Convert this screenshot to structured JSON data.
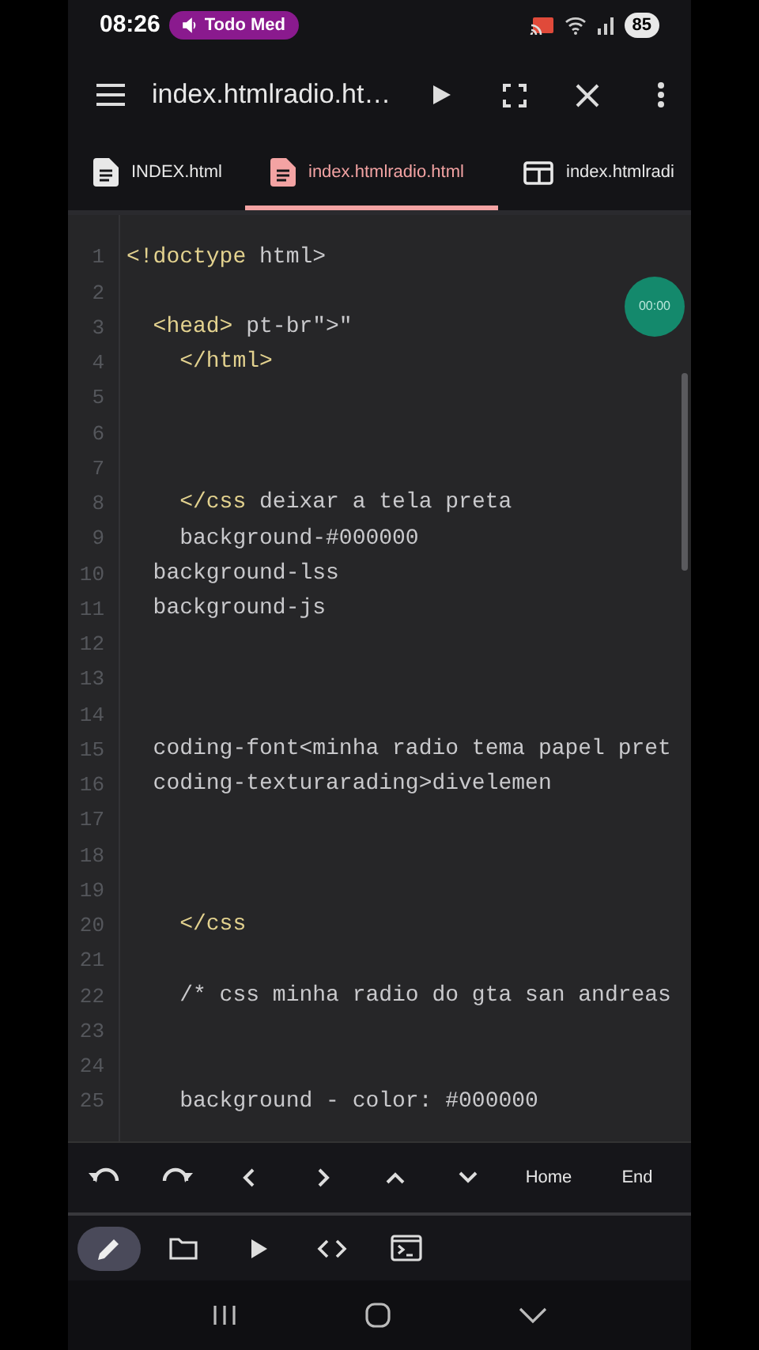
{
  "status_bar": {
    "time": "08:26",
    "media_pill": "Todo Med",
    "battery": "85"
  },
  "app_bar": {
    "title": "index.htmlradio.ht…"
  },
  "tabs": [
    {
      "label": "INDEX.html",
      "kind": "file",
      "selected": false
    },
    {
      "label": "index.htmlradio.html",
      "kind": "file",
      "selected": true
    },
    {
      "label": "index.htmlradi",
      "kind": "preview",
      "selected": false
    }
  ],
  "editor": {
    "lines": [
      {
        "number": "1",
        "segments": [
          {
            "kind": "tag",
            "text": "<!doctype"
          },
          {
            "kind": "text",
            "text": " html>"
          }
        ]
      },
      {
        "number": "2"
      },
      {
        "number": "3",
        "segments": [
          {
            "kind": "tag",
            "text": "  <head>"
          },
          {
            "kind": "text",
            "text": " pt-br\">\""
          }
        ]
      },
      {
        "number": "4",
        "segments": [
          {
            "kind": "tag",
            "text": "    </html>"
          }
        ]
      },
      {
        "number": "5"
      },
      {
        "number": "6"
      },
      {
        "number": "7"
      },
      {
        "number": "8",
        "segments": [
          {
            "kind": "tag",
            "text": "    </css"
          },
          {
            "kind": "text",
            "text": " deixar a tela preta"
          }
        ]
      },
      {
        "number": "9",
        "segments": [
          {
            "kind": "text",
            "text": "    background-#000000"
          }
        ]
      },
      {
        "number": "10",
        "segments": [
          {
            "kind": "text",
            "text": "  background-lss"
          }
        ]
      },
      {
        "number": "11",
        "segments": [
          {
            "kind": "text",
            "text": "  background-js"
          }
        ]
      },
      {
        "number": "12"
      },
      {
        "number": "13"
      },
      {
        "number": "14"
      },
      {
        "number": "15",
        "segments": [
          {
            "kind": "text",
            "text": "  coding-font<minha radio tema papel pret"
          }
        ]
      },
      {
        "number": "16",
        "segments": [
          {
            "kind": "text",
            "text": "  coding-texturarading>divelemen"
          }
        ]
      },
      {
        "number": "17"
      },
      {
        "number": "18"
      },
      {
        "number": "19"
      },
      {
        "number": "20",
        "segments": [
          {
            "kind": "tag",
            "text": "    </css"
          }
        ]
      },
      {
        "number": "21"
      },
      {
        "number": "22",
        "segments": [
          {
            "kind": "text",
            "text": "    /* css minha radio do gta san andreas"
          }
        ]
      },
      {
        "number": "23"
      },
      {
        "number": "24"
      },
      {
        "number": "25",
        "segments": [
          {
            "kind": "text",
            "text": "    background - color: #000000"
          }
        ]
      }
    ]
  },
  "recorder_badge": "00:00",
  "keys": [
    {
      "kind": "undo"
    },
    {
      "kind": "redo"
    },
    {
      "kind": "left"
    },
    {
      "kind": "right"
    },
    {
      "kind": "up"
    },
    {
      "kind": "down"
    },
    {
      "kind": "text",
      "label": "Home"
    },
    {
      "kind": "text",
      "label": "End"
    }
  ],
  "bottom_tabs": [
    {
      "kind": "edit",
      "selected": true
    },
    {
      "kind": "files",
      "selected": false
    },
    {
      "kind": "run",
      "selected": false
    },
    {
      "kind": "code",
      "selected": false
    },
    {
      "kind": "terminal",
      "selected": false
    }
  ]
}
